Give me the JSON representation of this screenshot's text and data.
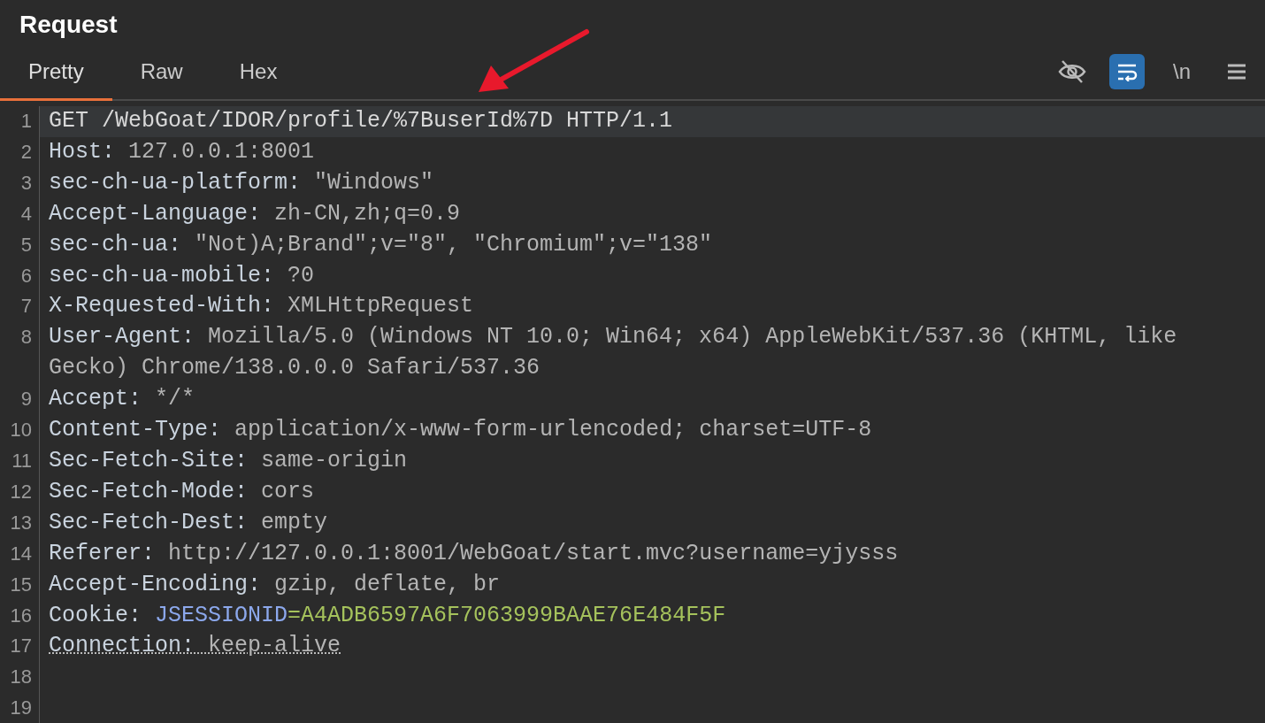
{
  "panel": {
    "title": "Request"
  },
  "tabs": [
    {
      "label": "Pretty",
      "selected": true
    },
    {
      "label": "Raw",
      "selected": false
    },
    {
      "label": "Hex",
      "selected": false
    }
  ],
  "toolbar": [
    {
      "kind": "hide",
      "selected": false
    },
    {
      "kind": "wrap",
      "selected": true
    },
    {
      "kind": "newline",
      "label": "\\n",
      "selected": false
    },
    {
      "kind": "menu",
      "selected": false
    }
  ],
  "annotation": {
    "kind": "arrow",
    "color": "#e8192c"
  },
  "lines": [
    {
      "number": "1",
      "highlighted": true,
      "underlined": false,
      "parts": [
        {
          "kind": "plain",
          "text": "GET /WebGoat/IDOR/profile/%7BuserId%7D HTTP/1.1"
        }
      ]
    },
    {
      "number": "2",
      "highlighted": false,
      "underlined": false,
      "parts": [
        {
          "kind": "name",
          "text": "Host: "
        },
        {
          "kind": "value",
          "text": "127.0.0.1:8001"
        }
      ]
    },
    {
      "number": "3",
      "highlighted": false,
      "underlined": false,
      "parts": [
        {
          "kind": "name",
          "text": "sec-ch-ua-platform: "
        },
        {
          "kind": "value",
          "text": "\"Windows\""
        }
      ]
    },
    {
      "number": "4",
      "highlighted": false,
      "underlined": false,
      "parts": [
        {
          "kind": "name",
          "text": "Accept-Language: "
        },
        {
          "kind": "value",
          "text": "zh-CN,zh;q=0.9"
        }
      ]
    },
    {
      "number": "5",
      "highlighted": false,
      "underlined": false,
      "parts": [
        {
          "kind": "name",
          "text": "sec-ch-ua: "
        },
        {
          "kind": "value",
          "text": "\"Not)A;Brand\";v=\"8\", \"Chromium\";v=\"138\""
        }
      ]
    },
    {
      "number": "6",
      "highlighted": false,
      "underlined": false,
      "parts": [
        {
          "kind": "name",
          "text": "sec-ch-ua-mobile: "
        },
        {
          "kind": "value",
          "text": "?0"
        }
      ]
    },
    {
      "number": "7",
      "highlighted": false,
      "underlined": false,
      "parts": [
        {
          "kind": "name",
          "text": "X-Requested-With: "
        },
        {
          "kind": "value",
          "text": "XMLHttpRequest"
        }
      ]
    },
    {
      "number": "8",
      "highlighted": false,
      "underlined": false,
      "parts": [
        {
          "kind": "name",
          "text": "User-Agent: "
        },
        {
          "kind": "value",
          "text": "Mozilla/5.0 (Windows NT 10.0; Win64; x64) AppleWebKit/537.36 (KHTML, like Gecko) Chrome/138.0.0.0 Safari/537.36"
        }
      ]
    },
    {
      "number": "9",
      "highlighted": false,
      "underlined": false,
      "parts": [
        {
          "kind": "name",
          "text": "Accept: "
        },
        {
          "kind": "value",
          "text": "*/*"
        }
      ]
    },
    {
      "number": "10",
      "highlighted": false,
      "underlined": false,
      "parts": [
        {
          "kind": "name",
          "text": "Content-Type: "
        },
        {
          "kind": "value",
          "text": "application/x-www-form-urlencoded; charset=UTF-8"
        }
      ]
    },
    {
      "number": "11",
      "highlighted": false,
      "underlined": false,
      "parts": [
        {
          "kind": "name",
          "text": "Sec-Fetch-Site: "
        },
        {
          "kind": "value",
          "text": "same-origin"
        }
      ]
    },
    {
      "number": "12",
      "highlighted": false,
      "underlined": false,
      "parts": [
        {
          "kind": "name",
          "text": "Sec-Fetch-Mode: "
        },
        {
          "kind": "value",
          "text": "cors"
        }
      ]
    },
    {
      "number": "13",
      "highlighted": false,
      "underlined": false,
      "parts": [
        {
          "kind": "name",
          "text": "Sec-Fetch-Dest: "
        },
        {
          "kind": "value",
          "text": "empty"
        }
      ]
    },
    {
      "number": "14",
      "highlighted": false,
      "underlined": false,
      "parts": [
        {
          "kind": "name",
          "text": "Referer: "
        },
        {
          "kind": "value",
          "text": "http://127.0.0.1:8001/WebGoat/start.mvc?username=yjysss"
        }
      ]
    },
    {
      "number": "15",
      "highlighted": false,
      "underlined": false,
      "parts": [
        {
          "kind": "name",
          "text": "Accept-Encoding: "
        },
        {
          "kind": "value",
          "text": "gzip, deflate, br"
        }
      ]
    },
    {
      "number": "16",
      "highlighted": false,
      "underlined": false,
      "parts": [
        {
          "kind": "name",
          "text": "Cookie: "
        },
        {
          "kind": "cookie-name",
          "text": "JSESSIONID"
        },
        {
          "kind": "cookie-value",
          "text": "=A4ADB6597A6F7063999BAAE76E484F5F"
        }
      ]
    },
    {
      "number": "17",
      "highlighted": false,
      "underlined": true,
      "parts": [
        {
          "kind": "name",
          "text": "Connection: "
        },
        {
          "kind": "value",
          "text": "keep-alive"
        }
      ]
    },
    {
      "number": "18",
      "highlighted": false,
      "underlined": false
    },
    {
      "number": "19",
      "highlighted": false,
      "underlined": false
    }
  ]
}
